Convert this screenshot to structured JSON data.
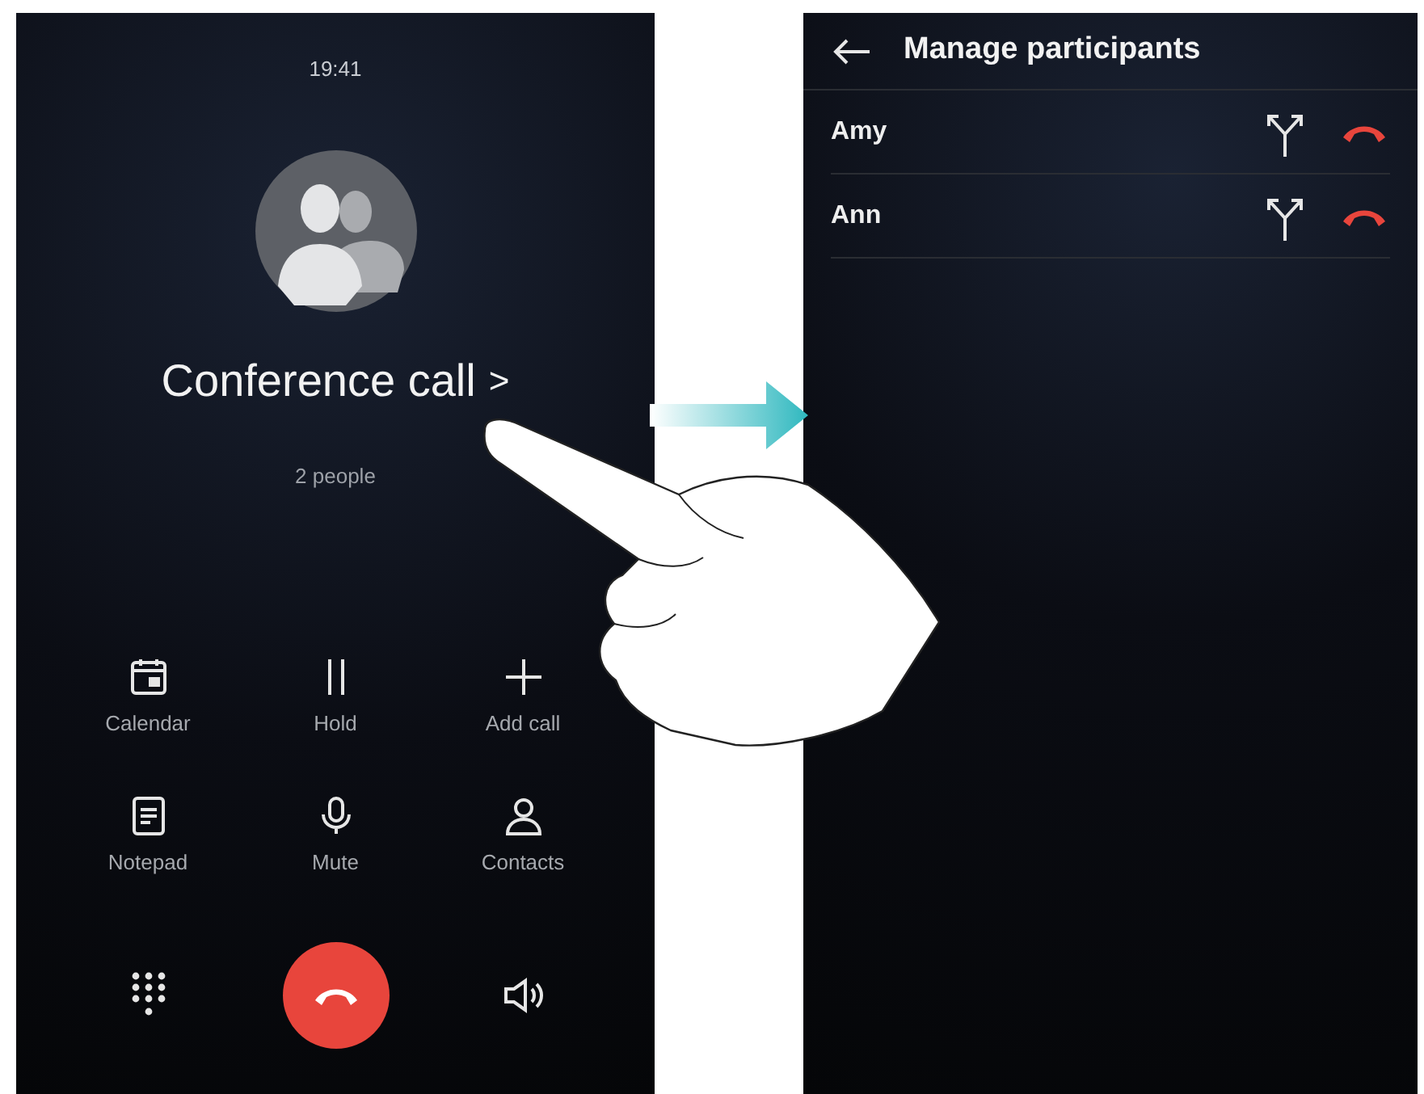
{
  "call_screen": {
    "time": "19:41",
    "title": "Conference call",
    "chevron": ">",
    "subtitle": "2 people",
    "actions": [
      {
        "label": "Calendar"
      },
      {
        "label": "Hold"
      },
      {
        "label": "Add call"
      },
      {
        "label": "Notepad"
      },
      {
        "label": "Mute"
      },
      {
        "label": "Contacts"
      }
    ]
  },
  "participants_screen": {
    "title": "Manage participants",
    "participants": [
      {
        "name": "Amy"
      },
      {
        "name": "Ann"
      }
    ]
  }
}
